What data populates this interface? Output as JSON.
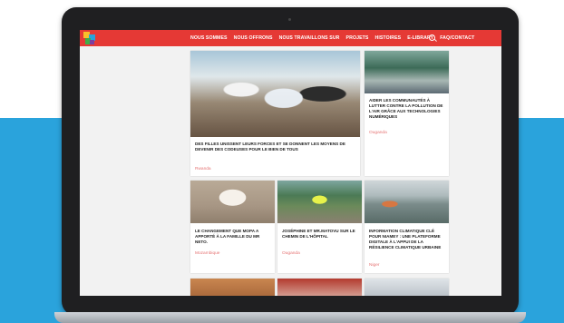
{
  "nav": {
    "items": [
      "NOUS SOMMES",
      "NOUS OFFRONS",
      "NOUS TRAVAILLONS SUR",
      "PROJETS",
      "HISTOIRES",
      "E-LIBRARY",
      "FAQ/CONTACT"
    ]
  },
  "cards": [
    {
      "title": "DES FILLES UNISSENT LEURS FORCES ET SE DONNENT LES MOYENS DE DEVENIR DES CODEUSES POUR LE BIEN DE TOUS",
      "tag": "Rwanda"
    },
    {
      "title": "AIDER LES COMMUNAUTÉS À LUTTER CONTRE LA POLLUTION DE L'AIR GRÂCE AUX TECHNOLOGIES NUMÉRIQUES",
      "tag": "Ouganda"
    },
    {
      "title": "LE CHANGEMENT QUE MOPA A APPORTÉ À LA FAMILLE DU MR NETO.",
      "tag": "Mozambique"
    },
    {
      "title": "JOSÉPHINE ET MR.MATOVU SUR LE CHEMIN DE L'HÔPITAL",
      "tag": "Ouganda"
    },
    {
      "title": "INFORMATION CLIMATIQUE CLÉ POUR NIAMEY : UNE PLATEFORME DIGITALE À L'APPUI DE LA RÉSILIENCE CLIMATIQUE URBAINE",
      "tag": "Niger"
    }
  ]
}
